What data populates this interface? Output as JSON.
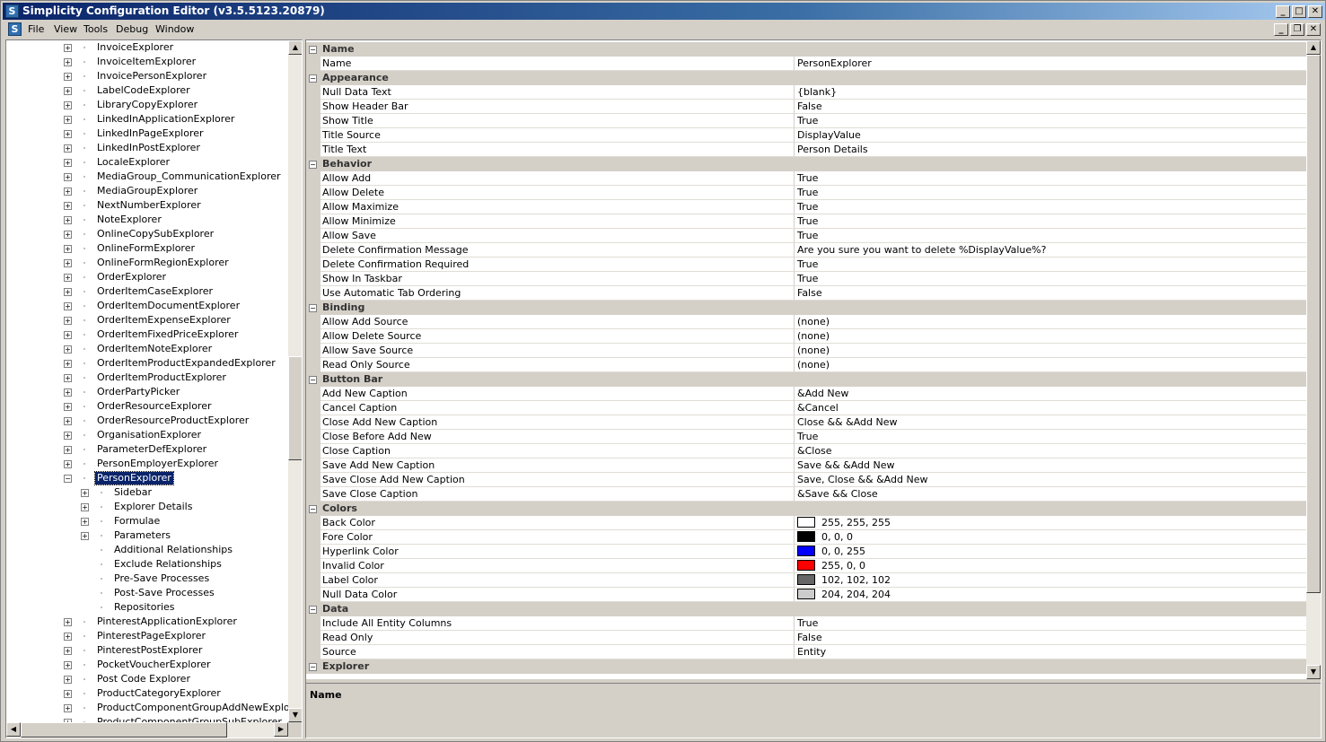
{
  "window": {
    "title": "Simplicity Configuration Editor (v3.5.5123.20879)",
    "app_icon_letter": "S",
    "buttons": {
      "minimize": "_",
      "maximize": "□",
      "close": "✕"
    }
  },
  "menu": {
    "items": [
      {
        "label": "File"
      },
      {
        "label": "View"
      },
      {
        "label": "Tools"
      },
      {
        "label": "Debug"
      },
      {
        "label": "Window"
      }
    ],
    "mdi_buttons": {
      "minimize": "_",
      "restore": "❐",
      "close": "✕"
    }
  },
  "tree": {
    "items": [
      {
        "label": "InvoiceExplorer",
        "level": 0,
        "expander": "+"
      },
      {
        "label": "InvoiceItemExplorer",
        "level": 0,
        "expander": "+"
      },
      {
        "label": "InvoicePersonExplorer",
        "level": 0,
        "expander": "+"
      },
      {
        "label": "LabelCodeExplorer",
        "level": 0,
        "expander": "+"
      },
      {
        "label": "LibraryCopyExplorer",
        "level": 0,
        "expander": "+"
      },
      {
        "label": "LinkedInApplicationExplorer",
        "level": 0,
        "expander": "+"
      },
      {
        "label": "LinkedInPageExplorer",
        "level": 0,
        "expander": "+"
      },
      {
        "label": "LinkedInPostExplorer",
        "level": 0,
        "expander": "+"
      },
      {
        "label": "LocaleExplorer",
        "level": 0,
        "expander": "+"
      },
      {
        "label": "MediaGroup_CommunicationExplorer",
        "level": 0,
        "expander": "+"
      },
      {
        "label": "MediaGroupExplorer",
        "level": 0,
        "expander": "+"
      },
      {
        "label": "NextNumberExplorer",
        "level": 0,
        "expander": "+"
      },
      {
        "label": "NoteExplorer",
        "level": 0,
        "expander": "+"
      },
      {
        "label": "OnlineCopySubExplorer",
        "level": 0,
        "expander": "+"
      },
      {
        "label": "OnlineFormExplorer",
        "level": 0,
        "expander": "+"
      },
      {
        "label": "OnlineFormRegionExplorer",
        "level": 0,
        "expander": "+"
      },
      {
        "label": "OrderExplorer",
        "level": 0,
        "expander": "+"
      },
      {
        "label": "OrderItemCaseExplorer",
        "level": 0,
        "expander": "+"
      },
      {
        "label": "OrderItemDocumentExplorer",
        "level": 0,
        "expander": "+"
      },
      {
        "label": "OrderItemExpenseExplorer",
        "level": 0,
        "expander": "+"
      },
      {
        "label": "OrderItemFixedPriceExplorer",
        "level": 0,
        "expander": "+"
      },
      {
        "label": "OrderItemNoteExplorer",
        "level": 0,
        "expander": "+"
      },
      {
        "label": "OrderItemProductExpandedExplorer",
        "level": 0,
        "expander": "+"
      },
      {
        "label": "OrderItemProductExplorer",
        "level": 0,
        "expander": "+"
      },
      {
        "label": "OrderPartyPicker",
        "level": 0,
        "expander": "+"
      },
      {
        "label": "OrderResourceExplorer",
        "level": 0,
        "expander": "+"
      },
      {
        "label": "OrderResourceProductExplorer",
        "level": 0,
        "expander": "+"
      },
      {
        "label": "OrganisationExplorer",
        "level": 0,
        "expander": "+"
      },
      {
        "label": "ParameterDefExplorer",
        "level": 0,
        "expander": "+"
      },
      {
        "label": "PersonEmployerExplorer",
        "level": 0,
        "expander": "+"
      },
      {
        "label": "PersonExplorer",
        "level": 0,
        "expander": "−",
        "selected": true
      },
      {
        "label": "Sidebar",
        "level": 1,
        "expander": "+"
      },
      {
        "label": "Explorer Details",
        "level": 1,
        "expander": "+"
      },
      {
        "label": "Formulae",
        "level": 1,
        "expander": "+"
      },
      {
        "label": "Parameters",
        "level": 1,
        "expander": "+"
      },
      {
        "label": "Additional Relationships",
        "level": 1,
        "expander": ""
      },
      {
        "label": "Exclude Relationships",
        "level": 1,
        "expander": ""
      },
      {
        "label": "Pre-Save Processes",
        "level": 1,
        "expander": ""
      },
      {
        "label": "Post-Save Processes",
        "level": 1,
        "expander": ""
      },
      {
        "label": "Repositories",
        "level": 1,
        "expander": ""
      },
      {
        "label": "PinterestApplicationExplorer",
        "level": 0,
        "expander": "+"
      },
      {
        "label": "PinterestPageExplorer",
        "level": 0,
        "expander": "+"
      },
      {
        "label": "PinterestPostExplorer",
        "level": 0,
        "expander": "+"
      },
      {
        "label": "PocketVoucherExplorer",
        "level": 0,
        "expander": "+"
      },
      {
        "label": "Post Code Explorer",
        "level": 0,
        "expander": "+"
      },
      {
        "label": "ProductCategoryExplorer",
        "level": 0,
        "expander": "+"
      },
      {
        "label": "ProductComponentGroupAddNewExplorer",
        "level": 0,
        "expander": "+"
      },
      {
        "label": "ProductComponentGroupSubExplorer",
        "level": 0,
        "expander": "+"
      }
    ],
    "scroll": {
      "up": "▲",
      "down": "▼",
      "left": "◀",
      "right": "▶"
    }
  },
  "grid": {
    "rows": [
      {
        "type": "cat",
        "label": "Name"
      },
      {
        "type": "prop",
        "name": "Name",
        "value": "PersonExplorer"
      },
      {
        "type": "cat",
        "label": "Appearance"
      },
      {
        "type": "prop",
        "name": "Null Data Text",
        "value": "{blank}"
      },
      {
        "type": "prop",
        "name": "Show Header Bar",
        "value": "False"
      },
      {
        "type": "prop",
        "name": "Show Title",
        "value": "True"
      },
      {
        "type": "prop",
        "name": "Title Source",
        "value": "DisplayValue"
      },
      {
        "type": "prop",
        "name": "Title Text",
        "value": "Person Details"
      },
      {
        "type": "cat",
        "label": "Behavior"
      },
      {
        "type": "prop",
        "name": "Allow Add",
        "value": "True"
      },
      {
        "type": "prop",
        "name": "Allow Delete",
        "value": "True"
      },
      {
        "type": "prop",
        "name": "Allow Maximize",
        "value": "True"
      },
      {
        "type": "prop",
        "name": "Allow Minimize",
        "value": "True"
      },
      {
        "type": "prop",
        "name": "Allow Save",
        "value": "True"
      },
      {
        "type": "prop",
        "name": "Delete Confirmation Message",
        "value": "Are you sure you want to delete %DisplayValue%?"
      },
      {
        "type": "prop",
        "name": "Delete Confirmation Required",
        "value": "True"
      },
      {
        "type": "prop",
        "name": "Show In Taskbar",
        "value": "True"
      },
      {
        "type": "prop",
        "name": "Use Automatic Tab Ordering",
        "value": "False"
      },
      {
        "type": "cat",
        "label": "Binding"
      },
      {
        "type": "prop",
        "name": "Allow Add Source",
        "value": "(none)"
      },
      {
        "type": "prop",
        "name": "Allow Delete Source",
        "value": "(none)"
      },
      {
        "type": "prop",
        "name": "Allow Save Source",
        "value": "(none)"
      },
      {
        "type": "prop",
        "name": "Read Only Source",
        "value": "(none)"
      },
      {
        "type": "cat",
        "label": "Button Bar"
      },
      {
        "type": "prop",
        "name": "Add New Caption",
        "value": "&Add New"
      },
      {
        "type": "prop",
        "name": "Cancel Caption",
        "value": "&Cancel"
      },
      {
        "type": "prop",
        "name": "Close Add New Caption",
        "value": "Close && &Add New"
      },
      {
        "type": "prop",
        "name": "Close Before Add New",
        "value": "True"
      },
      {
        "type": "prop",
        "name": "Close Caption",
        "value": "&Close"
      },
      {
        "type": "prop",
        "name": "Save Add New Caption",
        "value": "Save && &Add New"
      },
      {
        "type": "prop",
        "name": "Save Close Add New Caption",
        "value": "Save, Close && &Add New"
      },
      {
        "type": "prop",
        "name": "Save Close Caption",
        "value": "&Save && Close"
      },
      {
        "type": "cat",
        "label": "Colors"
      },
      {
        "type": "prop",
        "name": "Back Color",
        "value": "255, 255, 255",
        "swatch": "#ffffff"
      },
      {
        "type": "prop",
        "name": "Fore Color",
        "value": "0, 0, 0",
        "swatch": "#000000"
      },
      {
        "type": "prop",
        "name": "Hyperlink Color",
        "value": "0, 0, 255",
        "swatch": "#0000ff"
      },
      {
        "type": "prop",
        "name": "Invalid Color",
        "value": "255, 0, 0",
        "swatch": "#ff0000"
      },
      {
        "type": "prop",
        "name": "Label Color",
        "value": "102, 102, 102",
        "swatch": "#666666"
      },
      {
        "type": "prop",
        "name": "Null Data Color",
        "value": "204, 204, 204",
        "swatch": "#cccccc"
      },
      {
        "type": "cat",
        "label": "Data"
      },
      {
        "type": "prop",
        "name": "Include All Entity Columns",
        "value": "True"
      },
      {
        "type": "prop",
        "name": "Read Only",
        "value": "False"
      },
      {
        "type": "prop",
        "name": "Source",
        "value": "Entity"
      },
      {
        "type": "cat",
        "label": "Explorer"
      }
    ],
    "collapse_glyph": "−"
  },
  "description": {
    "title": "Name"
  }
}
